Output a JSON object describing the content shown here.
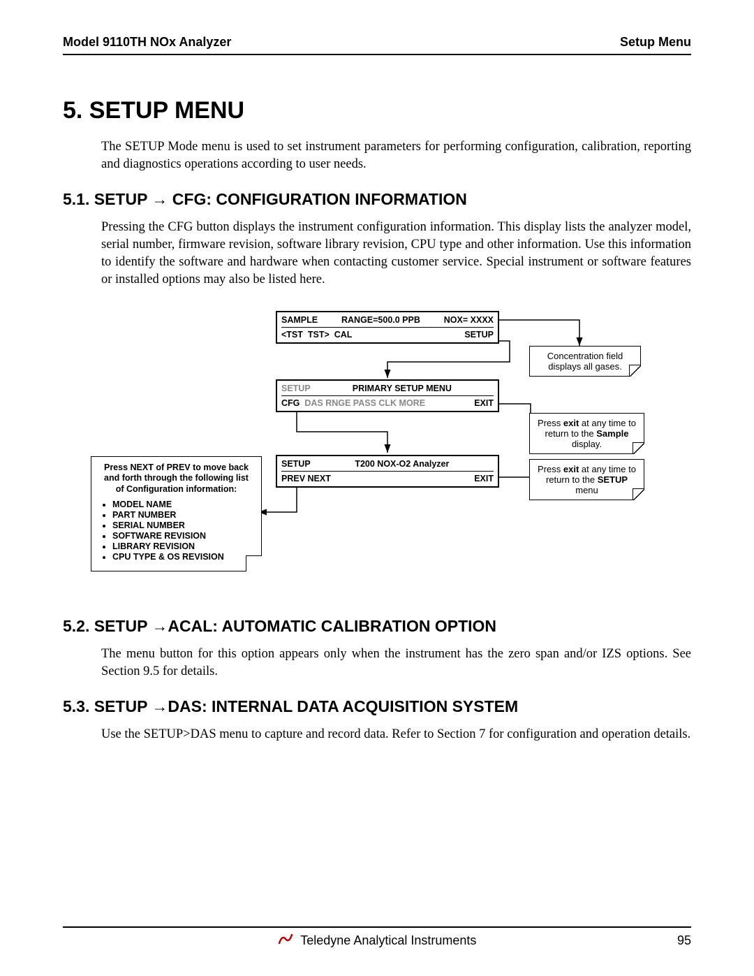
{
  "header": {
    "left": "Model 9110TH NOx Analyzer",
    "right": "Setup Menu"
  },
  "title": "5. SETUP MENU",
  "intro": "The SETUP Mode menu is used to set instrument parameters for performing configuration, calibration, reporting and diagnostics operations according to user needs.",
  "section51": {
    "heading": "5.1. SETUP → CFG: CONFIGURATION INFORMATION",
    "body": "Pressing the CFG button displays the instrument configuration information. This display lists the analyzer model, serial number, firmware revision, software library revision, CPU type and other information. Use this information to identify the software and hardware when contacting customer service. Special instrument or software features or installed options may also be listed here."
  },
  "diagram": {
    "screen1": {
      "l": "SAMPLE",
      "c": "RANGE=500.0 PPB",
      "r": "NOX= XXXX",
      "b1": "<TST",
      "b2": "TST>",
      "b3": "CAL",
      "b4": "SETUP"
    },
    "screen2": {
      "l": "SETUP",
      "c": "PRIMARY SETUP MENU",
      "b1": "CFG",
      "faded": "DAS  RNGE  PASS   CLK  MORE",
      "b4": "EXIT"
    },
    "screen3": {
      "l": "SETUP",
      "c": "T200 NOX-O2 Analyzer",
      "b1": "PREV",
      "b2": "NEXT",
      "b4": "EXIT"
    },
    "note1": "Concentration field displays all gases.",
    "note2_pre": "Press ",
    "note2_bold1": "exit",
    "note2_mid": " at any time to return to the ",
    "note2_bold2": "Sample",
    "note2_post": " display.",
    "note3_pre": "Press ",
    "note3_bold1": "exit",
    "note3_mid": " at any time to return to the ",
    "note3_bold2": "SETUP",
    "note3_post": " menu",
    "info_header": "Press NEXT of PREV to move back and forth through the following list of Configuration information:",
    "info_items": [
      "MODEL NAME",
      "PART NUMBER",
      "SERIAL NUMBER",
      "SOFTWARE REVISION",
      "LIBRARY REVISION",
      "CPU TYPE & OS REVISION"
    ]
  },
  "section52": {
    "heading": "5.2. SETUP →ACAL: AUTOMATIC CALIBRATION OPTION",
    "body": "The menu button for this option appears only when the instrument has the zero span and/or IZS options. See Section 9.5 for details."
  },
  "section53": {
    "heading": "5.3. SETUP →DAS: INTERNAL DATA ACQUISITION SYSTEM",
    "body": "Use the SETUP>DAS menu to capture and record data. Refer to Section 7 for configuration and operation details."
  },
  "footer": {
    "company": "Teledyne Analytical Instruments",
    "page": "95"
  }
}
